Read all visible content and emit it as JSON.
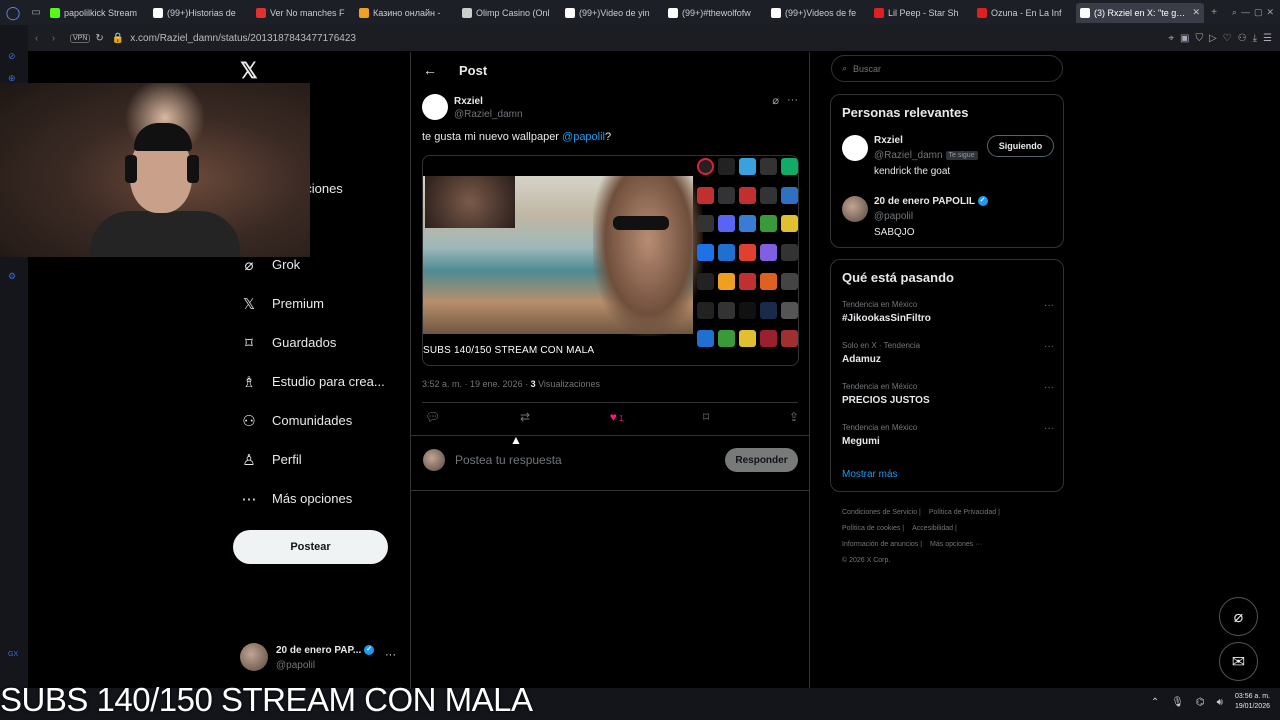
{
  "browser": {
    "tabs": [
      {
        "title": "papolilkick Stream",
        "color": "#53fc18"
      },
      {
        "title": "(99+)Historias de",
        "color": "#ffffff"
      },
      {
        "title": "Ver No manches F",
        "color": "#e03030"
      },
      {
        "title": "Казино онлайн -",
        "color": "#f0a020"
      },
      {
        "title": "Olimp Casino (Onl",
        "color": "#cccccc"
      },
      {
        "title": "(99+)Video de yin",
        "color": "#ffffff"
      },
      {
        "title": "(99+)#thewolfofw",
        "color": "#ffffff"
      },
      {
        "title": "(99+)Videos de fe",
        "color": "#ffffff"
      },
      {
        "title": "Lil Peep - Star Sh",
        "color": "#e02020"
      },
      {
        "title": "Ozuna - En La Inf",
        "color": "#e02020"
      },
      {
        "title": "(3) Rxziel en X: \"te gusta m",
        "color": "#ffffff",
        "active": true
      }
    ],
    "vpn_label": "VPN",
    "url": "x.com/Raziel_damn/status/2013187843477176423"
  },
  "sidebar": {
    "x_logo": "𝕏",
    "partial_items": [
      "ar",
      "aciones",
      "ar"
    ],
    "items": [
      {
        "label": "Grok",
        "icon": "grok-icon",
        "glyph": "⌀"
      },
      {
        "label": "Premium",
        "icon": "x-premium-icon",
        "glyph": "𝕏"
      },
      {
        "label": "Guardados",
        "icon": "bookmark-icon",
        "glyph": "🔖"
      },
      {
        "label": "Estudio para crea...",
        "icon": "creator-studio-icon",
        "glyph": "♗"
      },
      {
        "label": "Comunidades",
        "icon": "communities-icon",
        "glyph": "👥"
      },
      {
        "label": "Perfil",
        "icon": "profile-icon",
        "glyph": "👤"
      },
      {
        "label": "Más opciones",
        "icon": "more-options-icon",
        "glyph": "⋯"
      }
    ],
    "post_button": "Postear",
    "account": {
      "name": "20 de enero PAP...",
      "handle": "@papolil",
      "more": "···"
    }
  },
  "post": {
    "header_title": "Post",
    "author_name": "Rxziel",
    "author_handle": "@Raziel_damn",
    "text_before": "te gusta mi nuevo wallpaper ",
    "mention": "@papolil",
    "text_after": "?",
    "media_caption": "SUBS 140/150  STREAM CON MALA",
    "timestamp": "3:52 a. m. · 19 ene. 2026 · ",
    "views_count": "3",
    "views_label": " Visualizaciones",
    "likes_count": "1",
    "reply_placeholder": "Postea tu respuesta",
    "reply_button": "Responder"
  },
  "right": {
    "search_placeholder": "Buscar",
    "relevant_title": "Personas relevantes",
    "people": [
      {
        "name": "Rxziel",
        "handle": "@Raziel_damn",
        "follows_you": "Te sigue",
        "bio": "kendrick the goat",
        "button": "Siguiendo"
      },
      {
        "name": "20 de enero PAPOLIL",
        "handle": "@papolil",
        "bio": "SABQJO"
      }
    ],
    "trending_title": "Qué está pasando",
    "trends": [
      {
        "context": "Tendencia en México",
        "title": "#JikookasSinFiltro"
      },
      {
        "context": "Solo en X · Tendencia",
        "title": "Adamuz"
      },
      {
        "context": "Tendencia en México",
        "title": "PRECIOS JUSTOS"
      },
      {
        "context": "Tendencia en México",
        "title": "Megumi"
      }
    ],
    "show_more": "Mostrar más",
    "footer_links": [
      "Condiciones de Servicio |",
      "Política de Privacidad |",
      "Política de cookies |",
      "Accesibilidad |",
      "Información de anuncios |",
      "Más opciones ···"
    ],
    "copyright": "© 2026 X Corp."
  },
  "stream_overlay": "SUBS 140/150  STREAM CON MALA",
  "taskbar": {
    "time": "03:56 a. m.",
    "date": "19/01/2026"
  },
  "colors": {
    "accent": "#1d9bf0",
    "like": "#f91880",
    "bg": "#000000",
    "muted": "#71767b"
  }
}
